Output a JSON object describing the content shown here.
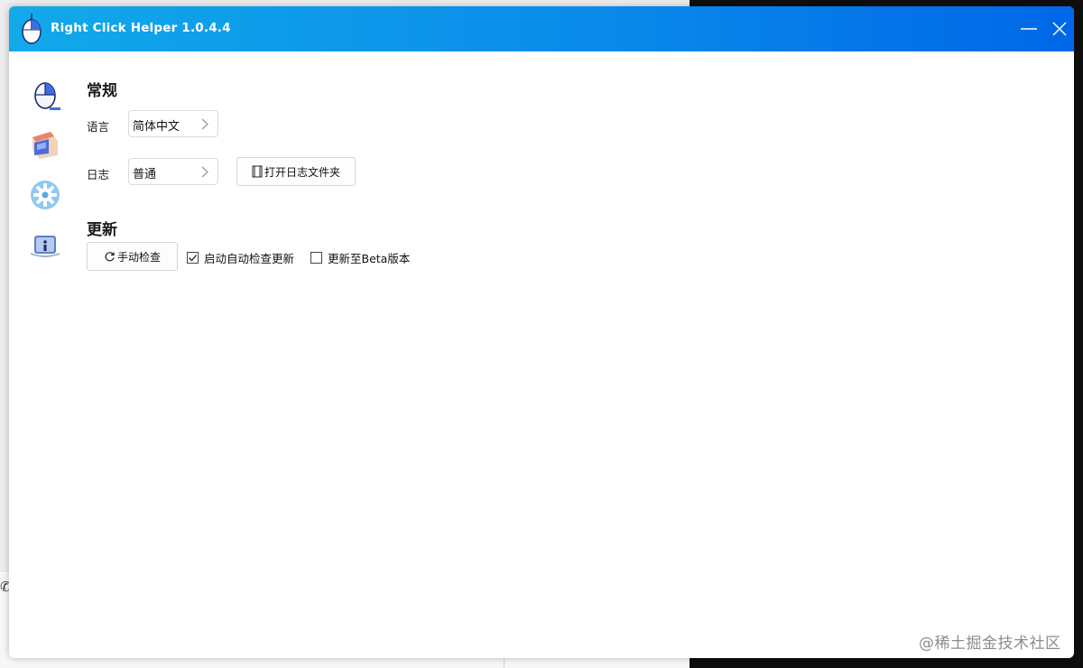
{
  "window": {
    "title": "Right Click Helper 1.0.4.4",
    "gradient_start": "#12a9ea",
    "gradient_end": "#0067e8"
  },
  "nav": [
    {
      "name": "mouse-icon"
    },
    {
      "name": "store-icon"
    },
    {
      "name": "gear-icon"
    },
    {
      "name": "info-icon"
    }
  ],
  "general": {
    "title": "常规",
    "language_label": "语言",
    "language_value": "简体中文",
    "log_label": "日志",
    "log_value": "普通",
    "open_log_folder": "打开日志文件夹"
  },
  "update": {
    "title": "更新",
    "manual_check": "手动检查",
    "auto_check_label": "启动自动检查更新",
    "auto_check_checked": true,
    "beta_label": "更新至Beta版本",
    "beta_checked": false
  },
  "watermark": "@稀土掘金技术社区"
}
